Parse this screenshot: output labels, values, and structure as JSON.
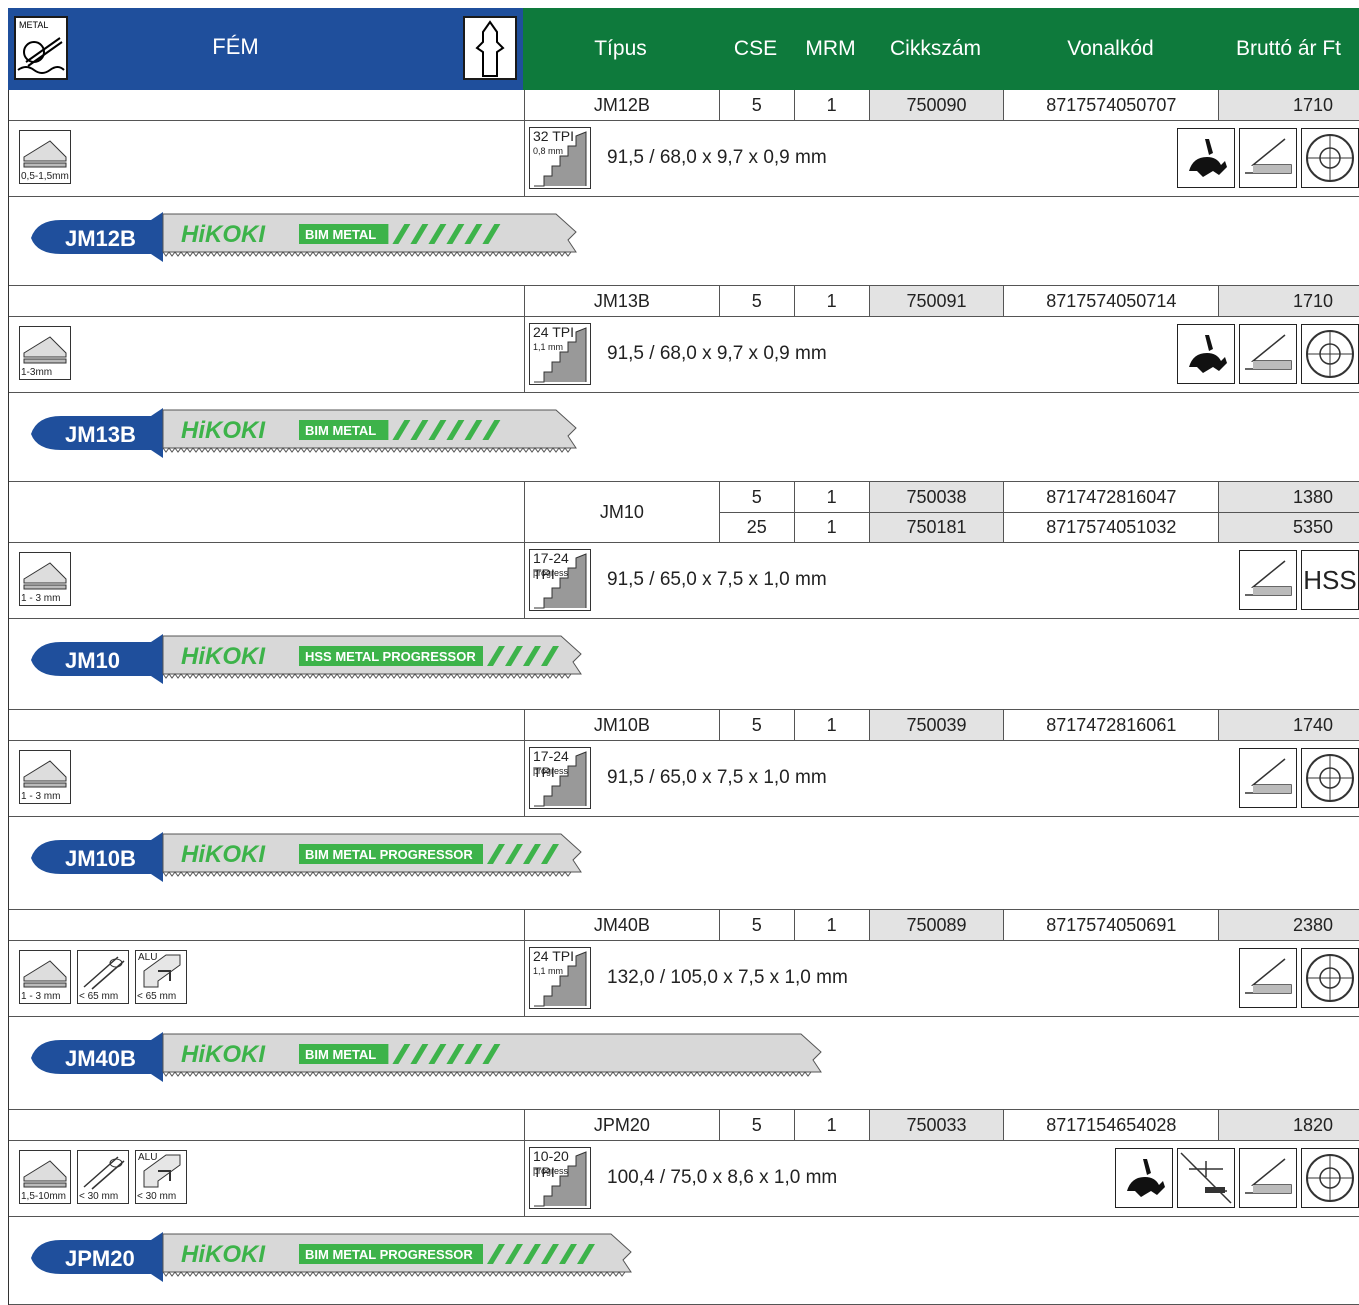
{
  "header": {
    "section_title": "FÉM",
    "metal_icon_label": "METAL",
    "columns": {
      "tipus": "Típus",
      "cse": "CSE",
      "mrm": "MRM",
      "cikkszam": "Cikkszám",
      "vonalkod": "Vonalkód",
      "ar": "Bruttó ár Ft"
    }
  },
  "products": [
    {
      "rows": [
        {
          "tipus": "JM12B",
          "cse": "5",
          "mrm": "1",
          "cikk": "750090",
          "vonal": "8717574050707",
          "ar": "1710"
        }
      ],
      "tpi": "32 TPI",
      "tpi_sub": "0,8 mm",
      "dims": "91,5 / 68,0 x 9,7 x 0,9 mm",
      "materials": [
        {
          "cap": "0,5-1,5mm",
          "tag": "",
          "icon": "sheet-icon"
        }
      ],
      "features": [
        "rabbit-icon",
        "straight-cut-icon",
        "bimetal-icon"
      ],
      "blade_name": "JM12B",
      "blade_brand": "HiKOKI",
      "blade_tag": "BIM METAL"
    },
    {
      "rows": [
        {
          "tipus": "JM13B",
          "cse": "5",
          "mrm": "1",
          "cikk": "750091",
          "vonal": "8717574050714",
          "ar": "1710"
        }
      ],
      "tpi": "24 TPI",
      "tpi_sub": "1,1 mm",
      "dims": "91,5 / 68,0 x 9,7 x 0,9 mm",
      "materials": [
        {
          "cap": "1-3mm",
          "tag": "",
          "icon": "sheet-icon"
        }
      ],
      "features": [
        "rabbit-icon",
        "straight-cut-icon",
        "bimetal-icon"
      ],
      "blade_name": "JM13B",
      "blade_brand": "HiKOKI",
      "blade_tag": "BIM METAL"
    },
    {
      "rows": [
        {
          "tipus": "JM10",
          "cse": "5",
          "mrm": "1",
          "cikk": "750038",
          "vonal": "8717472816047",
          "ar": "1380"
        },
        {
          "tipus": "",
          "cse": "25",
          "mrm": "1",
          "cikk": "750181",
          "vonal": "8717574051032",
          "ar": "5350"
        }
      ],
      "tpi": "17-24 TPI",
      "tpi_sub": "progressive",
      "dims": "91,5 / 65,0 x 7,5 x 1,0 mm",
      "materials": [
        {
          "cap": "1 - 3 mm",
          "tag": "",
          "icon": "sheet-icon"
        }
      ],
      "features": [
        "straight-cut-icon",
        "hss-icon"
      ],
      "feature_text": "HSS",
      "blade_name": "JM10",
      "blade_brand": "HiKOKI",
      "blade_tag": "HSS METAL PROGRESSOR"
    },
    {
      "rows": [
        {
          "tipus": "JM10B",
          "cse": "5",
          "mrm": "1",
          "cikk": "750039",
          "vonal": "8717472816061",
          "ar": "1740"
        }
      ],
      "tpi": "17-24 TPI",
      "tpi_sub": "progressive",
      "dims": "91,5 / 65,0 x 7,5 x 1,0 mm",
      "materials": [
        {
          "cap": "1 - 3 mm",
          "tag": "",
          "icon": "sheet-icon"
        }
      ],
      "features": [
        "straight-cut-icon",
        "bimetal-icon"
      ],
      "blade_name": "JM10B",
      "blade_brand": "HiKOKI",
      "blade_tag": "BIM METAL PROGRESSOR"
    },
    {
      "rows": [
        {
          "tipus": "JM40B",
          "cse": "5",
          "mrm": "1",
          "cikk": "750089",
          "vonal": "8717574050691",
          "ar": "2380"
        }
      ],
      "tpi": "24 TPI",
      "tpi_sub": "1,1 mm",
      "dims": "132,0 / 105,0 x 7,5 x 1,0 mm",
      "materials": [
        {
          "cap": "1 - 3 mm",
          "tag": "",
          "icon": "sheet-icon"
        },
        {
          "cap": "< 65 mm",
          "tag": "",
          "icon": "pipe-icon"
        },
        {
          "cap": "< 65 mm",
          "tag": "ALU",
          "icon": "profile-icon"
        }
      ],
      "features": [
        "straight-cut-icon",
        "bimetal-icon"
      ],
      "blade_name": "JM40B",
      "blade_brand": "HiKOKI",
      "blade_tag": "BIM METAL"
    },
    {
      "rows": [
        {
          "tipus": "JPM20",
          "cse": "5",
          "mrm": "1",
          "cikk": "750033",
          "vonal": "8717154654028",
          "ar": "1820"
        }
      ],
      "tpi": "10-20 TPI",
      "tpi_sub": "progressive",
      "dims": "100,4 / 75,0 x 8,6 x 1,0 mm",
      "materials": [
        {
          "cap": "1,5-10mm",
          "tag": "",
          "icon": "sheet-icon"
        },
        {
          "cap": "< 30 mm",
          "tag": "",
          "icon": "pipe-icon"
        },
        {
          "cap": "< 30 mm",
          "tag": "ALU",
          "icon": "profile-icon"
        }
      ],
      "features": [
        "rabbit-icon",
        "bevel-cut-icon",
        "straight-cut-icon",
        "bimetal-icon"
      ],
      "blade_name": "JPM20",
      "blade_brand": "HiKOKI",
      "blade_tag": "BIM METAL PROGRESSOR"
    }
  ]
}
